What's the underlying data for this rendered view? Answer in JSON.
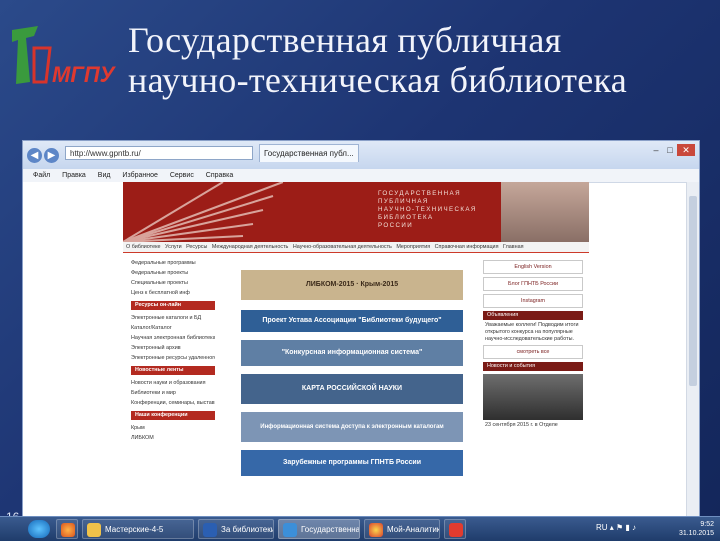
{
  "slide": {
    "title_line1": "Государственная публичная",
    "title_line2": "научно-техническая библиотека",
    "logo_text": "МГПУ",
    "slide_number": "16"
  },
  "browser": {
    "address": "http://www.gpntb.ru/",
    "tab_title": "Государственная публ...",
    "menu": [
      "Файл",
      "Правка",
      "Вид",
      "Избранное",
      "Сервис",
      "Справка"
    ]
  },
  "site": {
    "header_text": [
      "ГОСУДАРСТВЕННАЯ",
      "ПУБЛИЧНАЯ",
      "НАУЧНО-ТЕХНИЧЕСКАЯ",
      "БИБЛИОТЕКА",
      "РОССИИ"
    ],
    "nav": [
      "О библиотеке",
      "Услуги",
      "Ресурсы",
      "Международная деятельность",
      "Научно-образовательная деятельность",
      "Мероприятия",
      "Справочная информация",
      "Главная"
    ],
    "left_links": [
      "Федеральные программы",
      "Федеральные проекты",
      "Специальные проекты",
      "Ценз к бесплатной инф"
    ],
    "left_section1": "Ресурсы он-лайн",
    "left_links2": [
      "Электронные каталоги и БД",
      "Каталог/Каталог",
      "Научная электронная библиотека",
      "Электронный архив",
      "Электронные ресурсы удаленного доступа"
    ],
    "left_section2": "Новостные ленты",
    "left_links3": [
      "Новости науки и образования",
      "Библиотеки и мир",
      "Конференции, семинары, выставки и конкурсы"
    ],
    "left_section3": "Наши конференции",
    "left_links4": [
      "Крым",
      "ЛИБКОМ"
    ],
    "banners": [
      {
        "text": "ЛИБКОМ-2015 · Крым-2015",
        "color": "#c9b48e"
      },
      {
        "text": "Проект Устава Ассоциации \"Библиотеки будущего\"",
        "color": "#2f5f96"
      },
      {
        "text": "\"Конкурсная информационная система\"",
        "color": "#5f7fa4"
      },
      {
        "text": "КАРТА РОССИЙСКОЙ НАУКИ",
        "color": "#44648c"
      },
      {
        "text": "Информационная система доступа к электронным каталогам",
        "color": "#7d95b5"
      },
      {
        "text": "Зарубежные программы ГПНТБ России",
        "color": "#3668a8"
      }
    ],
    "right_boxes": [
      "English Version",
      "Блог ГПНТБ России",
      "Instagram"
    ],
    "right_header1": "Объявления",
    "right_text": "Уважаемые коллеги! Подводим итоги открытого конкурса на популярные научно-исследовательские работы.",
    "right_button": "смотреть все",
    "right_header2": "Новости и события",
    "right_date": "23 сентября 2015 г. в Отделе"
  },
  "taskbar": {
    "buttons": [
      "Мастерские-4-5",
      "За библиотеки...",
      "Государственная п...",
      "Мой-Аналитика_в..."
    ],
    "lang": "RU",
    "time": "9:52",
    "date": "31.10.2015"
  }
}
